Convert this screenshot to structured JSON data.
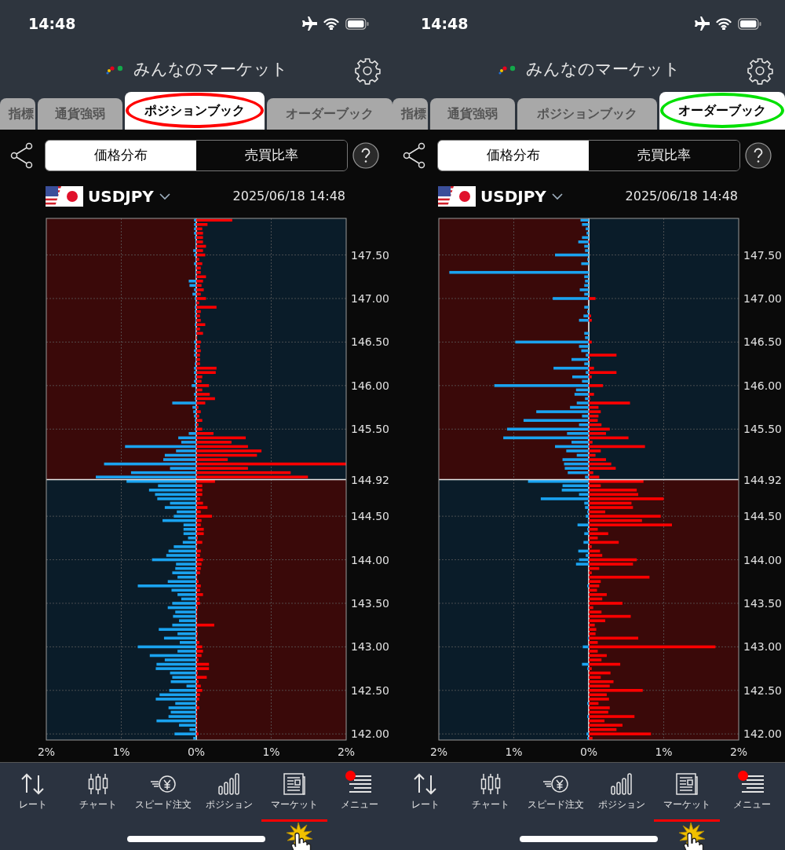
{
  "screens": [
    {
      "status_bar": {
        "time": "14:48"
      },
      "header": {
        "title": "みんなのマーケット"
      },
      "highlight": {
        "color": "#ff0000"
      },
      "tabs": [
        {
          "label": "指標",
          "selected": false
        },
        {
          "label": "通貨強弱",
          "selected": false
        },
        {
          "label": "ポジションブック",
          "selected": true
        },
        {
          "label": "オーダーブック",
          "selected": false
        }
      ],
      "segments": [
        {
          "label": "価格分布",
          "selected": true
        },
        {
          "label": "売買比率",
          "selected": false
        }
      ],
      "pair": "USDJPY",
      "timestamp": "2025/06/18 14:48",
      "chart_data": {
        "type": "bar",
        "orientation": "horizontal",
        "stacked": true,
        "grid": true,
        "xlim": [
          -2,
          2
        ],
        "ylim": [
          141.93,
          147.92
        ],
        "xticks": [
          {
            "value": -2,
            "label": "2%"
          },
          {
            "value": -1,
            "label": "1%"
          },
          {
            "value": 0,
            "label": "0%"
          },
          {
            "value": 1,
            "label": "1%"
          },
          {
            "value": 2,
            "label": "2%"
          }
        ],
        "yticks": [
          {
            "value": 147.5,
            "label": "147.50"
          },
          {
            "value": 147,
            "label": "147.00"
          },
          {
            "value": 146.5,
            "label": "146.50"
          },
          {
            "value": 146,
            "label": "146.00"
          },
          {
            "value": 145.5,
            "label": "145.50"
          },
          {
            "value": 144.5,
            "label": "144.50"
          },
          {
            "value": 144,
            "label": "144.00"
          },
          {
            "value": 143.5,
            "label": "143.50"
          },
          {
            "value": 143,
            "label": "143.00"
          },
          {
            "value": 142.5,
            "label": "142.50"
          },
          {
            "value": 142,
            "label": "142.00"
          }
        ],
        "ref_lines": [
          {
            "axis": "y",
            "value": 144.92,
            "label": "144.92"
          }
        ],
        "x": [
          147.9,
          147.85,
          147.8,
          147.75,
          147.7,
          147.65,
          147.6,
          147.55,
          147.5,
          147.45,
          147.4,
          147.35,
          147.3,
          147.25,
          147.2,
          147.15,
          147.1,
          147.05,
          147,
          146.95,
          146.9,
          146.85,
          146.8,
          146.75,
          146.7,
          146.65,
          146.6,
          146.55,
          146.5,
          146.45,
          146.4,
          146.35,
          146.3,
          146.25,
          146.2,
          146.15,
          146.1,
          146.05,
          146,
          145.95,
          145.9,
          145.85,
          145.8,
          145.75,
          145.7,
          145.65,
          145.6,
          145.55,
          145.5,
          145.45,
          145.4,
          145.35,
          145.3,
          145.25,
          145.2,
          145.15,
          145.1,
          145.05,
          145,
          144.95,
          144.9,
          144.85,
          144.8,
          144.75,
          144.7,
          144.65,
          144.6,
          144.55,
          144.5,
          144.45,
          144.4,
          144.35,
          144.3,
          144.25,
          144.2,
          144.15,
          144.1,
          144.05,
          144,
          143.95,
          143.9,
          143.85,
          143.8,
          143.75,
          143.7,
          143.65,
          143.6,
          143.55,
          143.5,
          143.45,
          143.4,
          143.35,
          143.3,
          143.25,
          143.2,
          143.15,
          143.1,
          143.05,
          143,
          142.95,
          142.9,
          142.85,
          142.8,
          142.75,
          142.7,
          142.65,
          142.6,
          142.55,
          142.5,
          142.45,
          142.4,
          142.35,
          142.3,
          142.25,
          142.2,
          142.15,
          142.1,
          142.05,
          142,
          141.95
        ],
        "series": [
          {
            "color": "#1aa3f0",
            "values": [
              -0.03,
              -0.03,
              -0.03,
              -0.03,
              -0.02,
              -0.01,
              -0.01,
              -0.04,
              -0.03,
              -0.01,
              -0.03,
              -0.01,
              -0.01,
              -0.01,
              -0.1,
              -0.09,
              -0.03,
              -0.05,
              -0.02,
              -0.01,
              -0.02,
              -0.02,
              -0.02,
              -0.01,
              -0.02,
              -0.01,
              -0.01,
              0,
              -0.03,
              -0.02,
              -0.03,
              -0.03,
              -0.01,
              -0.02,
              -0.03,
              -0.03,
              -0.02,
              -0.03,
              -0.06,
              -0.01,
              -0.03,
              -0.02,
              -0.32,
              -0.05,
              -0.04,
              -0.03,
              -0.02,
              -0.02,
              -0.02,
              -0.1,
              -0.24,
              -0.2,
              -0.95,
              -0.27,
              -0.42,
              -0.44,
              -1.23,
              -0.35,
              -0.87,
              -1.34,
              -0.93,
              -0.51,
              -0.63,
              -0.55,
              -0.52,
              -0.35,
              -0.42,
              -0.26,
              -0.3,
              -0.45,
              -0.17,
              -0.17,
              -0.17,
              -0.11,
              -0.18,
              -0.3,
              -0.37,
              -0.4,
              -0.59,
              -0.27,
              -0.28,
              -0.32,
              -0.25,
              -0.38,
              -0.78,
              -0.33,
              -0.25,
              -0.2,
              -0.32,
              -0.38,
              -0.28,
              -0.31,
              -0.23,
              -0.32,
              -0.5,
              -0.25,
              -0.43,
              -0.22,
              -0.78,
              -0.25,
              -0.62,
              -0.42,
              -0.53,
              -0.54,
              -0.35,
              -0.32,
              -0.34,
              -0.13,
              -0.36,
              -0.49,
              -0.54,
              -0.28,
              -0.37,
              -0.34,
              -0.37,
              -0.53,
              -0.23,
              -0.09,
              -0.29,
              -0.04
            ]
          },
          {
            "color": "#ff0000",
            "values": [
              0.48,
              0.15,
              0.08,
              0.09,
              0.09,
              0.09,
              0.13,
              0.09,
              0.12,
              0.04,
              0.08,
              0.06,
              0.06,
              0.13,
              0.09,
              0.07,
              0.1,
              0.06,
              0.13,
              0.04,
              0.27,
              0.06,
              0.05,
              0.06,
              0.12,
              0.05,
              0.09,
              0.01,
              0.06,
              0.05,
              0.06,
              0.05,
              0.05,
              0.05,
              0.27,
              0.26,
              0.08,
              0.07,
              0.17,
              0.08,
              0.18,
              0.25,
              0.12,
              0.03,
              0.06,
              0.04,
              0.08,
              0.03,
              0.08,
              0.23,
              0.66,
              0.47,
              0.69,
              0.87,
              0.81,
              0.42,
              2.0,
              0.69,
              1.26,
              1.49,
              0.25,
              0.08,
              0.08,
              0.08,
              0.05,
              0.09,
              0.15,
              0.06,
              0.21,
              0.07,
              0.06,
              0.1,
              0.1,
              0.02,
              0.08,
              0.01,
              0.06,
              0.05,
              0.09,
              0.07,
              0.06,
              0.05,
              0.01,
              0.03,
              0.06,
              0.05,
              0.09,
              0.04,
              0.05,
              0.02,
              0.01,
              0.01,
              0.01,
              0.24,
              0.01,
              0.02,
              0.01,
              0.04,
              0.08,
              0.09,
              0.07,
              0.03,
              0.17,
              0.17,
              0.02,
              0.14,
              0.03,
              0.06,
              0.08,
              0.05,
              0.04,
              0.01,
              0.04,
              0.01,
              0.01,
              0.01,
              0.01,
              0.01,
              0.03,
              0
            ]
          }
        ]
      },
      "nav": [
        {
          "label": "レート",
          "tapped": false,
          "badge": false
        },
        {
          "label": "チャート",
          "tapped": false,
          "badge": false
        },
        {
          "label": "スピード注文",
          "tapped": false,
          "badge": false
        },
        {
          "label": "ポジション",
          "tapped": false,
          "badge": false
        },
        {
          "label": "マーケット",
          "tapped": true,
          "badge": false
        },
        {
          "label": "メニュー",
          "tapped": false,
          "badge": true
        }
      ]
    },
    {
      "status_bar": {
        "time": "14:48"
      },
      "header": {
        "title": "みんなのマーケット"
      },
      "highlight": {
        "color": "#00e000"
      },
      "tabs": [
        {
          "label": "指標",
          "selected": false
        },
        {
          "label": "通貨強弱",
          "selected": false
        },
        {
          "label": "ポジションブック",
          "selected": false
        },
        {
          "label": "オーダーブック",
          "selected": true
        }
      ],
      "segments": [
        {
          "label": "価格分布",
          "selected": true
        },
        {
          "label": "売買比率",
          "selected": false
        }
      ],
      "pair": "USDJPY",
      "timestamp": "2025/06/18 14:48",
      "chart_data": {
        "type": "bar",
        "orientation": "horizontal",
        "stacked": true,
        "grid": true,
        "xlim": [
          -2,
          2
        ],
        "ylim": [
          141.93,
          147.92
        ],
        "xticks": [
          {
            "value": -2,
            "label": "2%"
          },
          {
            "value": -1,
            "label": "1%"
          },
          {
            "value": 0,
            "label": "0%"
          },
          {
            "value": 1,
            "label": "1%"
          },
          {
            "value": 2,
            "label": "2%"
          }
        ],
        "yticks": [
          {
            "value": 147.5,
            "label": "147.50"
          },
          {
            "value": 147,
            "label": "147.00"
          },
          {
            "value": 146.5,
            "label": "146.50"
          },
          {
            "value": 146,
            "label": "146.00"
          },
          {
            "value": 145.5,
            "label": "145.50"
          },
          {
            "value": 144.5,
            "label": "144.50"
          },
          {
            "value": 144,
            "label": "144.00"
          },
          {
            "value": 143.5,
            "label": "143.50"
          },
          {
            "value": 143,
            "label": "143.00"
          },
          {
            "value": 142.5,
            "label": "142.50"
          },
          {
            "value": 142,
            "label": "142.00"
          }
        ],
        "ref_lines": [
          {
            "axis": "y",
            "value": 144.92,
            "label": "144.92"
          }
        ],
        "x": [
          147.9,
          147.85,
          147.8,
          147.75,
          147.7,
          147.65,
          147.6,
          147.55,
          147.5,
          147.45,
          147.4,
          147.3,
          147.25,
          147.2,
          147.15,
          147.1,
          147.05,
          147,
          146.9,
          146.85,
          146.8,
          146.75,
          146.6,
          146.55,
          146.5,
          146.45,
          146.4,
          146.35,
          146.3,
          146.25,
          146.2,
          146.15,
          146.1,
          146.05,
          146,
          145.95,
          145.9,
          145.85,
          145.8,
          145.75,
          145.7,
          145.65,
          145.6,
          145.55,
          145.5,
          145.45,
          145.4,
          145.35,
          145.3,
          145.25,
          145.2,
          145.15,
          145.1,
          145.05,
          145,
          144.95,
          144.9,
          144.85,
          144.8,
          144.75,
          144.7,
          144.65,
          144.6,
          144.55,
          144.5,
          144.45,
          144.4,
          144.35,
          144.3,
          144.25,
          144.2,
          144.15,
          144.1,
          144.05,
          144,
          143.95,
          143.9,
          143.85,
          143.8,
          143.75,
          143.7,
          143.65,
          143.6,
          143.55,
          143.5,
          143.45,
          143.4,
          143.35,
          143.3,
          143.25,
          143.2,
          143.15,
          143.1,
          143.05,
          143,
          142.95,
          142.9,
          142.85,
          142.8,
          142.75,
          142.7,
          142.65,
          142.6,
          142.55,
          142.5,
          142.45,
          142.4,
          142.35,
          142.3,
          142.25,
          142.2,
          142.15,
          142.1,
          142.05,
          142,
          141.95
        ],
        "series": [
          {
            "color": "#1aa3f0",
            "values": [
              -0.11,
              -0.09,
              -0.04,
              -0.03,
              -0.09,
              -0.14,
              -0.06,
              -0.05,
              -0.45,
              -0.02,
              -0.1,
              -1.86,
              -0.06,
              -0.05,
              -0.06,
              -0.12,
              -0.06,
              -0.48,
              -0.06,
              -0.02,
              -0.07,
              -0.13,
              -0.06,
              -0.05,
              -0.98,
              -0.13,
              -0.1,
              -0.04,
              -0.23,
              -0.06,
              -0.47,
              -0.04,
              -0.22,
              -0.09,
              -1.26,
              -0.17,
              -0.19,
              -0.05,
              -0.16,
              -0.25,
              -0.7,
              -0.09,
              -0.87,
              -0.13,
              -1.09,
              -0.29,
              -1.14,
              -0.23,
              -0.45,
              -0.3,
              -0.16,
              -0.35,
              -0.33,
              -0.32,
              -0.28,
              -0.05,
              -0.81,
              -0.35,
              -0.36,
              -0.13,
              -0.64,
              -0.06,
              -0.05,
              -0.02,
              -0.04,
              -0.01,
              -0.15,
              -0.02,
              -0.06,
              0,
              -0.07,
              0,
              -0.14,
              -0.04,
              -0.13,
              -0.17,
              0,
              0,
              0,
              0,
              -0.02,
              0,
              0,
              0,
              0,
              0,
              0,
              0,
              0,
              0,
              0,
              0,
              -0.01,
              0,
              -0.08,
              0,
              0,
              0,
              -0.09,
              -0.02,
              0,
              0,
              0,
              0,
              0,
              0,
              0,
              -0.02,
              0,
              0,
              -0.02,
              0,
              0,
              0,
              -0.03,
              -0.02
            ]
          },
          {
            "color": "#ff0000",
            "values": [
              0,
              0,
              0,
              0,
              0,
              0.01,
              0,
              0,
              0,
              0,
              0,
              0,
              0,
              0,
              0,
              0,
              0,
              0.09,
              0,
              0,
              0.03,
              0.04,
              0,
              0,
              0.04,
              0,
              0,
              0.37,
              0.02,
              0,
              0.07,
              0.37,
              0.04,
              0,
              0.19,
              0,
              0.07,
              0.02,
              0.55,
              0.13,
              0.16,
              0.13,
              0.12,
              0.17,
              0.28,
              0.23,
              0.53,
              0.05,
              0.75,
              0.16,
              0.09,
              0.23,
              0.3,
              0.36,
              0.06,
              0.14,
              0.73,
              0.16,
              0.64,
              0.66,
              1.0,
              0.57,
              0.59,
              0.22,
              0.96,
              0.71,
              1.11,
              0.12,
              0.26,
              0.12,
              0.4,
              0.04,
              0.15,
              0.18,
              0.64,
              0.59,
              0.14,
              0.04,
              0.81,
              0.16,
              0.14,
              0.11,
              0.24,
              0.18,
              0.45,
              0.06,
              0.17,
              0.56,
              0.22,
              0.08,
              0.1,
              0.09,
              0.66,
              0.12,
              1.69,
              0.12,
              0.24,
              0.17,
              0.42,
              0.04,
              0.29,
              0.16,
              0.33,
              0.28,
              0.72,
              0.24,
              0.27,
              0.13,
              0.28,
              0.26,
              0.61,
              0.21,
              0.45,
              0.37,
              0.83,
              0.05
            ]
          }
        ]
      },
      "nav": [
        {
          "label": "レート",
          "tapped": false,
          "badge": false
        },
        {
          "label": "チャート",
          "tapped": false,
          "badge": false
        },
        {
          "label": "スピード注文",
          "tapped": false,
          "badge": false
        },
        {
          "label": "ポジション",
          "tapped": false,
          "badge": false
        },
        {
          "label": "マーケット",
          "tapped": true,
          "badge": false
        },
        {
          "label": "メニュー",
          "tapped": false,
          "badge": true
        }
      ]
    }
  ]
}
